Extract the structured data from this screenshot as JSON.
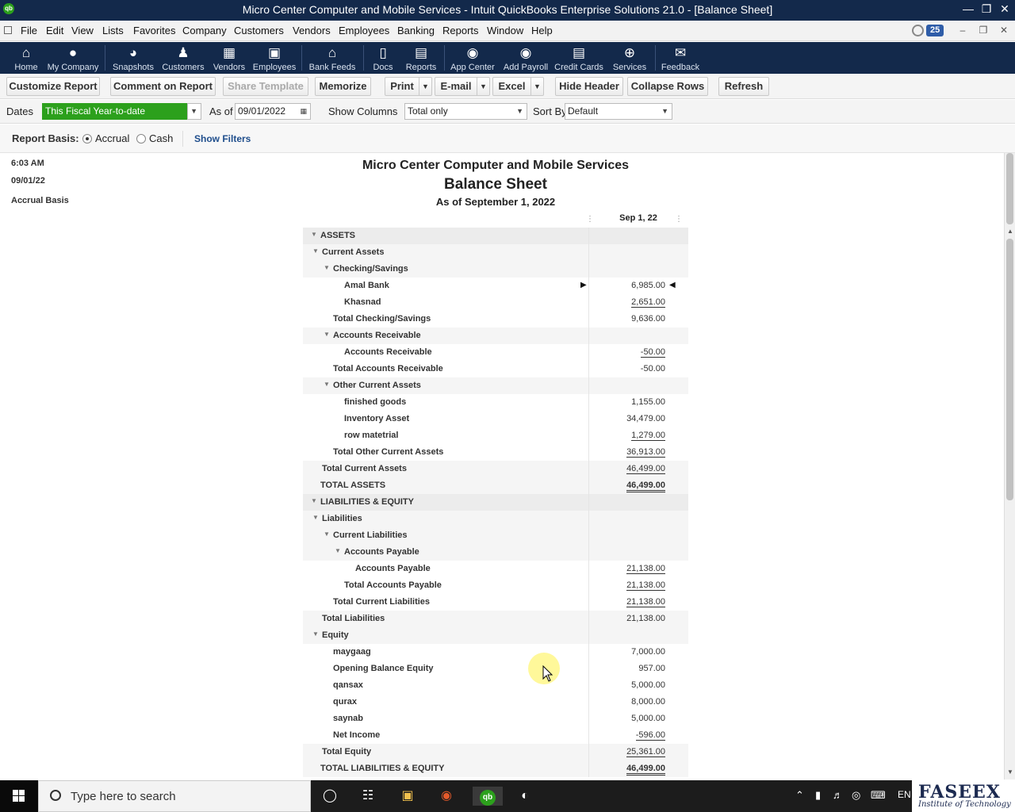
{
  "window": {
    "title": "Micro Center Computer and Mobile Services  - Intuit QuickBooks Enterprise Solutions 21.0 - [Balance Sheet]",
    "logo_text": "qb"
  },
  "menu": {
    "items": [
      "File",
      "Edit",
      "View",
      "Lists",
      "Favorites",
      "Company",
      "Customers",
      "Vendors",
      "Employees",
      "Banking",
      "Reports",
      "Window",
      "Help"
    ],
    "reminder_count": "25"
  },
  "iconbar": {
    "items": [
      {
        "label": "Home",
        "icon": "home-icon"
      },
      {
        "label": "My Company",
        "icon": "my-company-icon"
      },
      {
        "label": "Snapshots",
        "icon": "snapshots-icon"
      },
      {
        "label": "Customers",
        "icon": "customers-icon"
      },
      {
        "label": "Vendors",
        "icon": "vendors-icon"
      },
      {
        "label": "Employees",
        "icon": "employees-icon"
      },
      {
        "label": "Bank Feeds",
        "icon": "bank-icon"
      },
      {
        "label": "Docs",
        "icon": "docs-icon"
      },
      {
        "label": "Reports",
        "icon": "reports-icon"
      },
      {
        "label": "App Center",
        "icon": "app-center-icon"
      },
      {
        "label": "Add Payroll",
        "icon": "payroll-icon"
      },
      {
        "label": "Credit Cards",
        "icon": "credit-card-icon"
      },
      {
        "label": "Services",
        "icon": "services-icon"
      },
      {
        "label": "Feedback",
        "icon": "feedback-icon"
      }
    ]
  },
  "report_buttons": {
    "customize": "Customize Report",
    "comment": "Comment on Report",
    "share": "Share Template",
    "memorize": "Memorize",
    "print": "Print",
    "email": "E-mail",
    "excel": "Excel",
    "hide_header": "Hide Header",
    "collapse": "Collapse Rows",
    "refresh": "Refresh"
  },
  "filters": {
    "dates_label": "Dates",
    "dates_value": "This Fiscal Year-to-date",
    "as_of_label": "As of",
    "as_of_value": "09/01/2022",
    "show_columns_label": "Show Columns",
    "show_columns_value": "Total only",
    "sort_by_label": "Sort By",
    "sort_by_value": "Default"
  },
  "basis": {
    "label": "Report Basis:",
    "accrual": "Accrual",
    "cash": "Cash",
    "selected": "accrual",
    "show_filters": "Show Filters"
  },
  "report": {
    "time": "6:03 AM",
    "date": "09/01/22",
    "basis_text": "Accrual Basis",
    "company": "Micro Center Computer and Mobile Services",
    "title": "Balance Sheet",
    "subtitle": "As of September 1, 2022",
    "column_header": "Sep 1, 22",
    "rows": [
      {
        "label": "ASSETS",
        "indent": 0,
        "amount": "",
        "style": "header",
        "collapsible": true
      },
      {
        "label": "Current Assets",
        "indent": 1,
        "amount": "",
        "style": "group",
        "collapsible": true
      },
      {
        "label": "Checking/Savings",
        "indent": 2,
        "amount": "",
        "style": "group",
        "collapsible": true
      },
      {
        "label": "Amal Bank",
        "indent": 3,
        "amount": "6,985.00",
        "style": "item",
        "pointer": true
      },
      {
        "label": "Khasnad",
        "indent": 3,
        "amount": "2,651.00",
        "style": "item",
        "underline": true
      },
      {
        "label": "Total Checking/Savings",
        "indent": 2,
        "amount": "9,636.00",
        "style": "total"
      },
      {
        "label": "Accounts Receivable",
        "indent": 2,
        "amount": "",
        "style": "group",
        "collapsible": true
      },
      {
        "label": "Accounts Receivable",
        "indent": 3,
        "amount": "-50.00",
        "style": "item",
        "underline": true
      },
      {
        "label": "Total Accounts Receivable",
        "indent": 2,
        "amount": "-50.00",
        "style": "total"
      },
      {
        "label": "Other Current Assets",
        "indent": 2,
        "amount": "",
        "style": "group",
        "collapsible": true
      },
      {
        "label": "finished goods",
        "indent": 3,
        "amount": "1,155.00",
        "style": "item"
      },
      {
        "label": "Inventory Asset",
        "indent": 3,
        "amount": "34,479.00",
        "style": "item"
      },
      {
        "label": "row matetrial",
        "indent": 3,
        "amount": "1,279.00",
        "style": "item",
        "underline": true
      },
      {
        "label": "Total Other Current Assets",
        "indent": 2,
        "amount": "36,913.00",
        "style": "total",
        "underline": true
      },
      {
        "label": "Total Current Assets",
        "indent": 1,
        "amount": "46,499.00",
        "style": "total-shade",
        "underline": true
      },
      {
        "label": "TOTAL ASSETS",
        "indent": 0,
        "amount": "46,499.00",
        "style": "grand"
      },
      {
        "label": "LIABILITIES & EQUITY",
        "indent": 0,
        "amount": "",
        "style": "header",
        "collapsible": true
      },
      {
        "label": "Liabilities",
        "indent": 1,
        "amount": "",
        "style": "group",
        "collapsible": true
      },
      {
        "label": "Current Liabilities",
        "indent": 2,
        "amount": "",
        "style": "group",
        "collapsible": true
      },
      {
        "label": "Accounts Payable",
        "indent": 3,
        "amount": "",
        "style": "group",
        "collapsible": true
      },
      {
        "label": "Accounts Payable",
        "indent": 4,
        "amount": "21,138.00",
        "style": "item",
        "underline": true
      },
      {
        "label": "Total Accounts Payable",
        "indent": 3,
        "amount": "21,138.00",
        "style": "total",
        "underline": true
      },
      {
        "label": "Total Current Liabilities",
        "indent": 2,
        "amount": "21,138.00",
        "style": "total",
        "underline": true
      },
      {
        "label": "Total Liabilities",
        "indent": 1,
        "amount": "21,138.00",
        "style": "total-shade"
      },
      {
        "label": "Equity",
        "indent": 1,
        "amount": "",
        "style": "group",
        "collapsible": true
      },
      {
        "label": "maygaag",
        "indent": 2,
        "amount": "7,000.00",
        "style": "item"
      },
      {
        "label": "Opening Balance Equity",
        "indent": 2,
        "amount": "957.00",
        "style": "item"
      },
      {
        "label": "qansax",
        "indent": 2,
        "amount": "5,000.00",
        "style": "item"
      },
      {
        "label": "qurax",
        "indent": 2,
        "amount": "8,000.00",
        "style": "item"
      },
      {
        "label": "saynab",
        "indent": 2,
        "amount": "5,000.00",
        "style": "item"
      },
      {
        "label": "Net Income",
        "indent": 2,
        "amount": "-596.00",
        "style": "item",
        "underline": true
      },
      {
        "label": "Total Equity",
        "indent": 1,
        "amount": "25,361.00",
        "style": "total-shade",
        "underline": true
      },
      {
        "label": "TOTAL LIABILITIES & EQUITY",
        "indent": 0,
        "amount": "46,499.00",
        "style": "grand"
      }
    ]
  },
  "taskbar": {
    "search_placeholder": "Type here to search",
    "lang": "EN"
  },
  "watermark": {
    "brand": "FASEEX",
    "tagline": "Institute of Technology"
  },
  "colors": {
    "navy": "#13294b",
    "qb_green": "#2ca01c",
    "badge_blue": "#2f5da8"
  }
}
